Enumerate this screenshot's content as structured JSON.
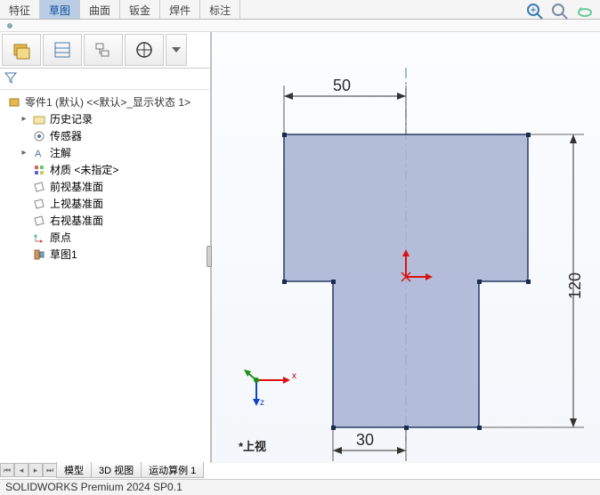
{
  "top_tabs": {
    "items": [
      "特征",
      "草图",
      "曲面",
      "钣金",
      "焊件",
      "标注"
    ],
    "active_index": 1
  },
  "view_tools": [
    "zoom-to-fit-icon",
    "zoom-window-icon",
    "rotate-view-icon"
  ],
  "feature_tree": {
    "root": "零件1 (默认) <<默认>_显示状态 1>",
    "history": "历史记录",
    "sensors": "传感器",
    "annotations": "注解",
    "material": "材质 <未指定>",
    "front_plane": "前视基准面",
    "top_plane": "上视基准面",
    "right_plane": "右视基准面",
    "origin": "原点",
    "sketch1": "草图1"
  },
  "chart_data": {
    "type": "diagram",
    "title": "T-shaped sketch profile",
    "dimensions": {
      "top_width": 50,
      "overall_height": 120,
      "bottom_width": 30
    },
    "view_label": "*上视"
  },
  "triad_axes": {
    "x": "x",
    "z": "z"
  },
  "bottom_tabs": {
    "items": [
      "模型",
      "3D 视图",
      "运动算例 1"
    ]
  },
  "status_text": "SOLIDWORKS Premium 2024 SP0.1"
}
